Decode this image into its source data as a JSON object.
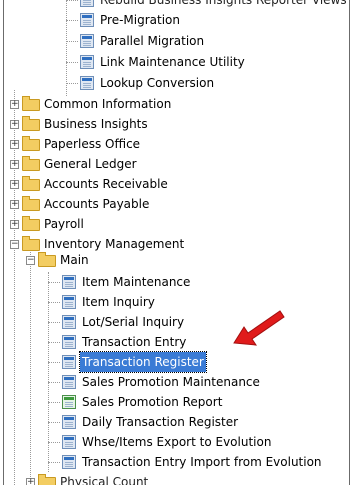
{
  "tree": {
    "top_partial_label": "Rebuild Business Insights Reporter Views",
    "items_top": [
      {
        "label": "Pre-Migration"
      },
      {
        "label": "Parallel Migration"
      },
      {
        "label": "Link Maintenance Utility"
      },
      {
        "label": "Lookup Conversion"
      }
    ],
    "modules": [
      {
        "label": "Common Information",
        "expander": "+"
      },
      {
        "label": "Business Insights",
        "expander": "+"
      },
      {
        "label": "Paperless Office",
        "expander": "+"
      },
      {
        "label": "General Ledger",
        "expander": "+"
      },
      {
        "label": "Accounts Receivable",
        "expander": "+"
      },
      {
        "label": "Accounts Payable",
        "expander": "+"
      },
      {
        "label": "Payroll",
        "expander": "+"
      },
      {
        "label": "Inventory Management",
        "expander": "−"
      }
    ],
    "main_folder": {
      "label": "Main",
      "expander": "−"
    },
    "main_items": [
      {
        "label": "Item Maintenance"
      },
      {
        "label": "Item Inquiry"
      },
      {
        "label": "Lot/Serial Inquiry"
      },
      {
        "label": "Transaction Entry"
      },
      {
        "label": "Transaction Register",
        "selected": true
      },
      {
        "label": "Sales Promotion Maintenance"
      },
      {
        "label": "Sales Promotion Report"
      },
      {
        "label": "Daily Transaction Register"
      },
      {
        "label": "Whse/Items Export to Evolution"
      },
      {
        "label": "Transaction Entry Import from Evolution"
      }
    ],
    "bottom_partial_label": "Physical Count"
  },
  "colors": {
    "selection": "#3a7bd5",
    "arrow": "#e01b1b",
    "folder": "#f3cd62"
  }
}
